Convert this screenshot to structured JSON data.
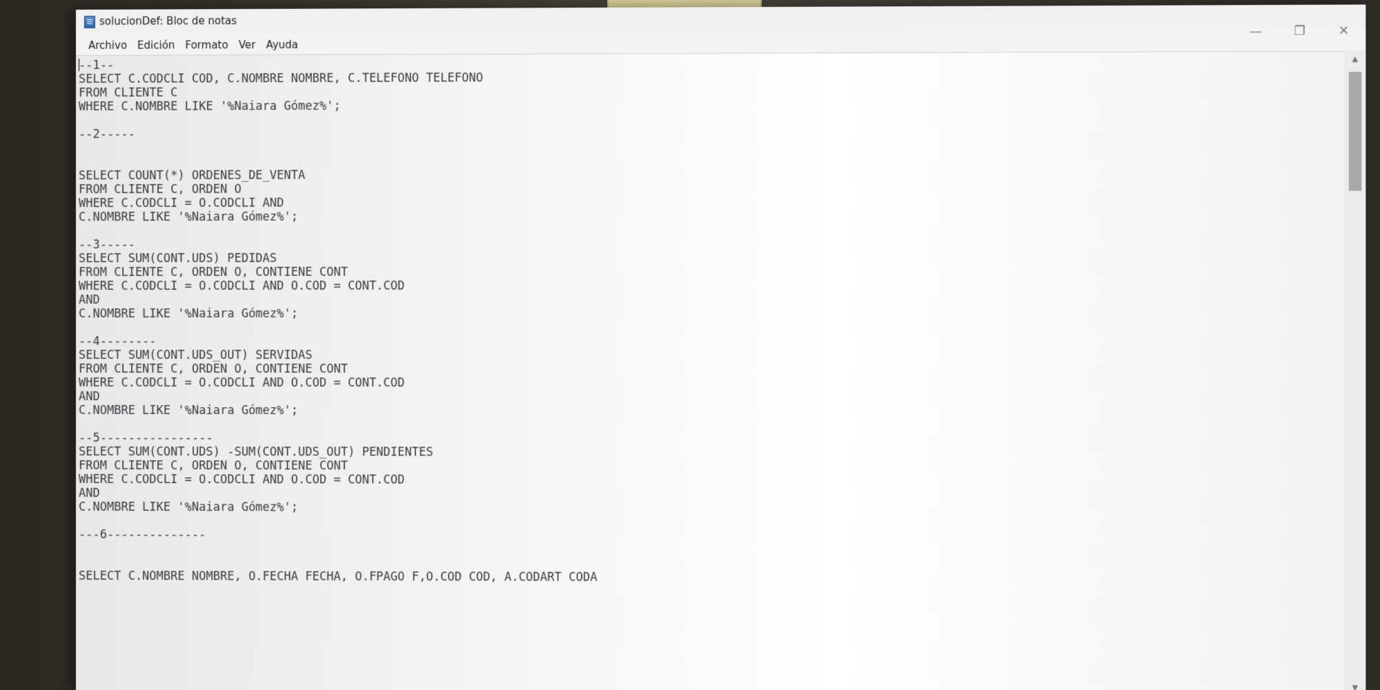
{
  "window": {
    "title": "solucionDef: Bloc de notas",
    "minimize_glyph": "—",
    "maximize_glyph": "❐",
    "close_glyph": "✕"
  },
  "menu": [
    "Archivo",
    "Edición",
    "Formato",
    "Ver",
    "Ayuda"
  ],
  "editor": {
    "lines": [
      "--1--",
      "SELECT C.CODCLI COD, C.NOMBRE NOMBRE, C.TELEFONO TELEFONO",
      "FROM CLIENTE C",
      "WHERE C.NOMBRE LIKE '%Naiara Gómez%';",
      "",
      "--2-----",
      "",
      "",
      "SELECT COUNT(*) ORDENES_DE_VENTA",
      "FROM CLIENTE C, ORDEN O",
      "WHERE C.CODCLI = O.CODCLI AND",
      "C.NOMBRE LIKE '%Naiara Gómez%';",
      "",
      "--3-----",
      "SELECT SUM(CONT.UDS) PEDIDAS",
      "FROM CLIENTE C, ORDEN O, CONTIENE CONT",
      "WHERE C.CODCLI = O.CODCLI AND O.COD = CONT.COD",
      "AND",
      "C.NOMBRE LIKE '%Naiara Gómez%';",
      "",
      "--4--------",
      "SELECT SUM(CONT.UDS_OUT) SERVIDAS",
      "FROM CLIENTE C, ORDEN O, CONTIENE CONT",
      "WHERE C.CODCLI = O.CODCLI AND O.COD = CONT.COD",
      "AND",
      "C.NOMBRE LIKE '%Naiara Gómez%';",
      "",
      "--5----------------",
      "SELECT SUM(CONT.UDS) -SUM(CONT.UDS_OUT) PENDIENTES",
      "FROM CLIENTE C, ORDEN O, CONTIENE CONT",
      "WHERE C.CODCLI = O.CODCLI AND O.COD = CONT.COD",
      "AND",
      "C.NOMBRE LIKE '%Naiara Gómez%';",
      "",
      "---6--------------",
      "",
      "",
      "SELECT C.NOMBRE NOMBRE, O.FECHA FECHA, O.FPAGO F,O.COD COD, A.CODART CODA"
    ]
  },
  "scrollbar": {
    "up_glyph": "▲",
    "down_glyph": "▼"
  }
}
